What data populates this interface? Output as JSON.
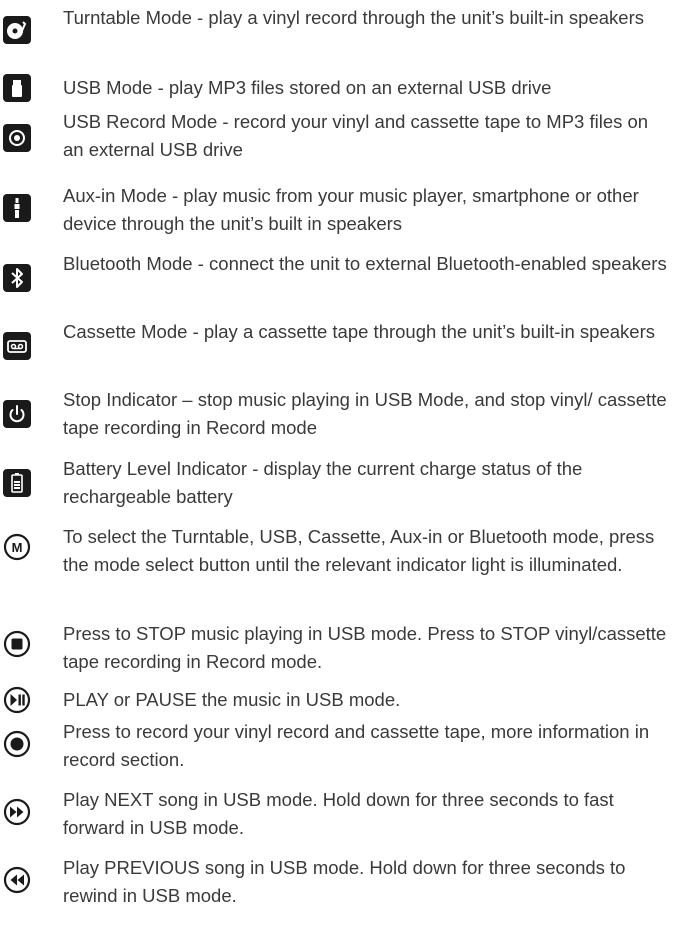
{
  "items": [
    {
      "icon": "turntable-icon",
      "text": "Turntable Mode - play a vinyl record through the unit’s built-in speakers"
    },
    {
      "icon": "usb-drive-icon",
      "text": "USB Mode - play MP3 files stored on an external USB drive"
    },
    {
      "icon": "usb-record-icon",
      "text": "USB Record Mode - record your vinyl and cassette tape to MP3 files on an external USB drive"
    },
    {
      "icon": "aux-jack-icon",
      "text": "Aux-in Mode - play music from your music player, smartphone or other device through the unit’s built in speakers"
    },
    {
      "icon": "bluetooth-icon",
      "text": "Bluetooth Mode - connect the unit to external Bluetooth-enabled speakers"
    },
    {
      "icon": "cassette-icon",
      "text": "Cassette Mode - play a cassette tape through the unit’s built-in speakers"
    },
    {
      "icon": "power-icon",
      "text": "Stop Indicator – stop music playing in USB Mode, and stop vinyl/ cassette tape recording in Record mode"
    },
    {
      "icon": "battery-icon",
      "text": "Battery Level Indicator - display the current charge status of the rechargeable battery"
    },
    {
      "icon": "mode-button-icon",
      "text": "To select the Turntable, USB, Cassette, Aux-in or Bluetooth mode, press the mode select button until the relevant indicator light is illuminated."
    },
    {
      "icon": "stop-button-icon",
      "text": "Press to STOP music playing in USB mode. Press to STOP vinyl/cassette tape recording in Record mode."
    },
    {
      "icon": "play-pause-button-icon",
      "text": "PLAY or PAUSE the music in USB mode."
    },
    {
      "icon": "record-button-icon",
      "text": "Press to record your vinyl record and cassette tape, more information in record section."
    },
    {
      "icon": "next-button-icon",
      "text": "Play NEXT song in USB mode. Hold down for three seconds to fast forward in USB mode."
    },
    {
      "icon": "previous-button-icon",
      "text": "Play PREVIOUS song in USB mode. Hold down for three seconds to rewind in USB mode."
    }
  ],
  "colors": {
    "text": "#3a3a3a",
    "icon": "#1a1a1a"
  }
}
